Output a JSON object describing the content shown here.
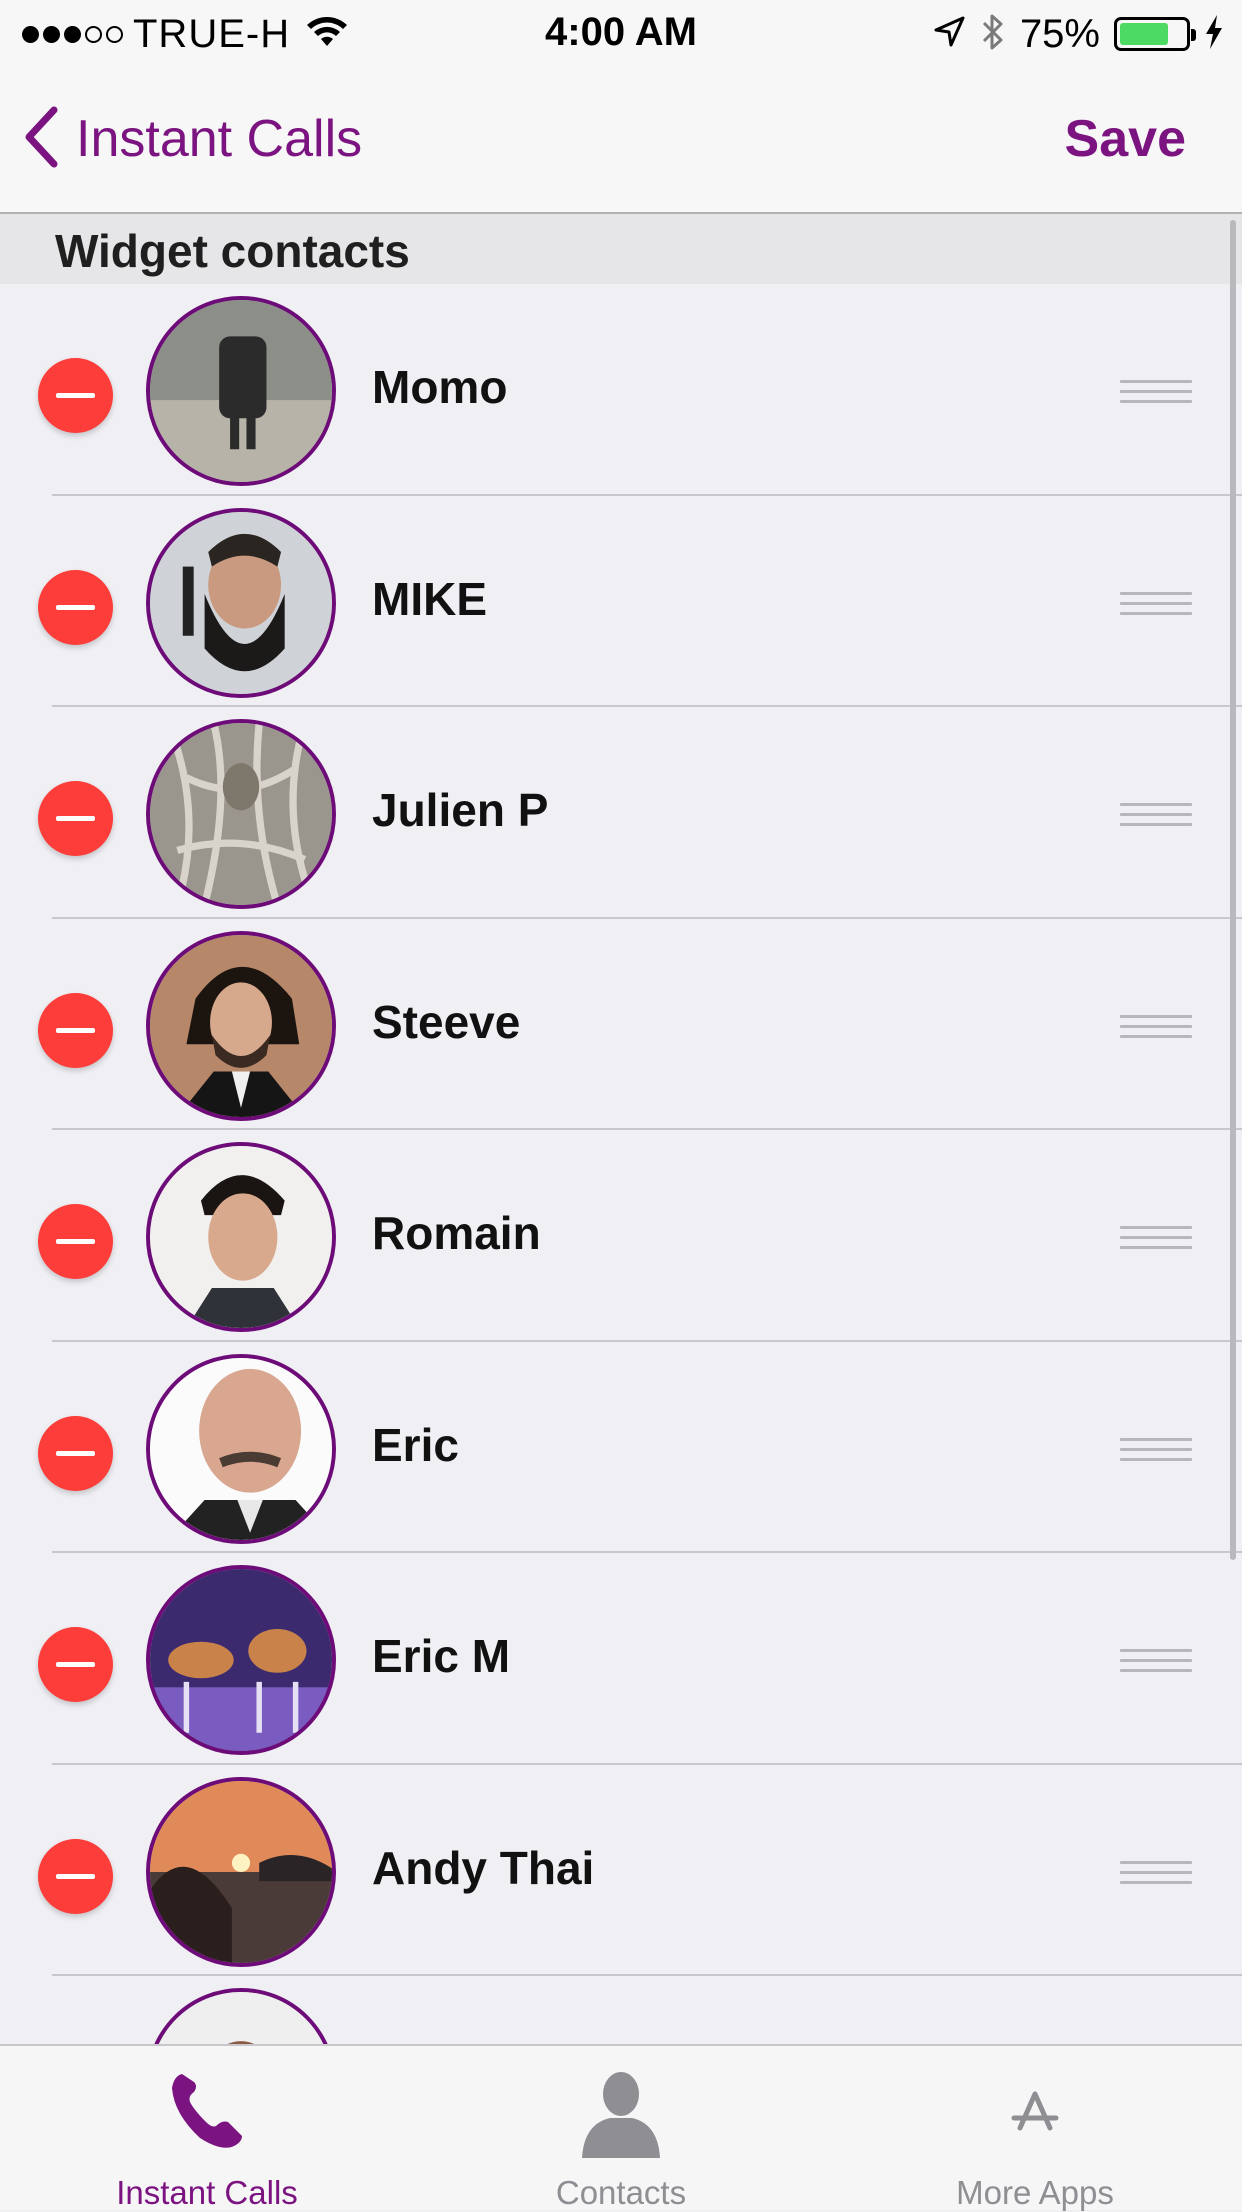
{
  "status_bar": {
    "carrier": "TRUE-H",
    "time": "4:00 AM",
    "battery_percent": "75%",
    "battery_level": 0.75,
    "signal_bars_filled": 3,
    "signal_bars_total": 5
  },
  "nav": {
    "back_label": "Instant Calls",
    "save_label": "Save"
  },
  "section": {
    "title": "Widget contacts"
  },
  "contacts": [
    {
      "name": "Momo"
    },
    {
      "name": "MIKE"
    },
    {
      "name": "Julien P"
    },
    {
      "name": "Steeve"
    },
    {
      "name": "Romain"
    },
    {
      "name": "Eric"
    },
    {
      "name": "Eric M"
    },
    {
      "name": "Andy Thai"
    }
  ],
  "tabs": [
    {
      "label": "Instant Calls",
      "icon": "phone-icon",
      "active": true
    },
    {
      "label": "Contacts",
      "icon": "person-icon",
      "active": false
    },
    {
      "label": "More Apps",
      "icon": "app-store-icon",
      "active": false
    }
  ],
  "colors": {
    "accent": "#7b1480",
    "delete": "#fc3d39",
    "avatar_border": "#6d0c78",
    "battery": "#4cd964"
  }
}
